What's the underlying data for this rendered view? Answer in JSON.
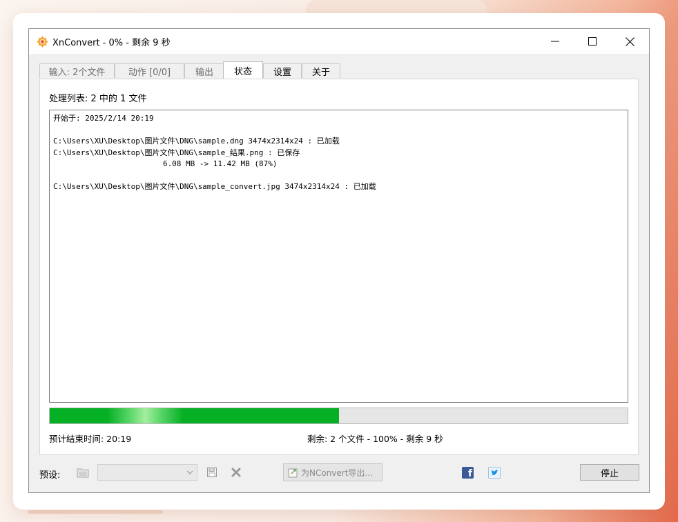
{
  "window": {
    "title": "XnConvert - 0% - 剩余 9 秒",
    "controls": {
      "minimize_icon": "minimize-icon",
      "maximize_icon": "maximize-icon",
      "close_icon": "close-icon"
    }
  },
  "tabs": [
    {
      "label": "输入: 2个文件",
      "active": false
    },
    {
      "label": "动作 [0/0]",
      "active": false
    },
    {
      "label": "输出",
      "active": false
    },
    {
      "label": "状态",
      "active": true
    },
    {
      "label": "设置",
      "active": false
    },
    {
      "label": "关于",
      "active": false
    }
  ],
  "status": {
    "processing_label": "处理列表: 2 中的 1 文件",
    "log_lines": [
      "开始于: 2025/2/14 20:19",
      "",
      "C:\\Users\\XU\\Desktop\\图片文件\\DNG\\sample.dng 3474x2314x24 : 已加载",
      "C:\\Users\\XU\\Desktop\\图片文件\\DNG\\sample_结果.png : 已保存",
      "                        6.08 MB -> 11.42 MB (87%)",
      "",
      "C:\\Users\\XU\\Desktop\\图片文件\\DNG\\sample_convert.jpg 3474x2314x24 : 已加载"
    ],
    "progress_fraction": 0.5,
    "eta_label": "预计结束时间: 20:19",
    "remaining_label": "剩余: 2 个文件 - 100% - 剩余 9 秒",
    "progress_color": "#06b025"
  },
  "bottom": {
    "preset_label": "预设:",
    "preset_selected": "",
    "export_label": "为NConvert导出…",
    "facebook_icon": "facebook-icon",
    "twitter_icon": "twitter-icon",
    "stop_label": "停止"
  }
}
